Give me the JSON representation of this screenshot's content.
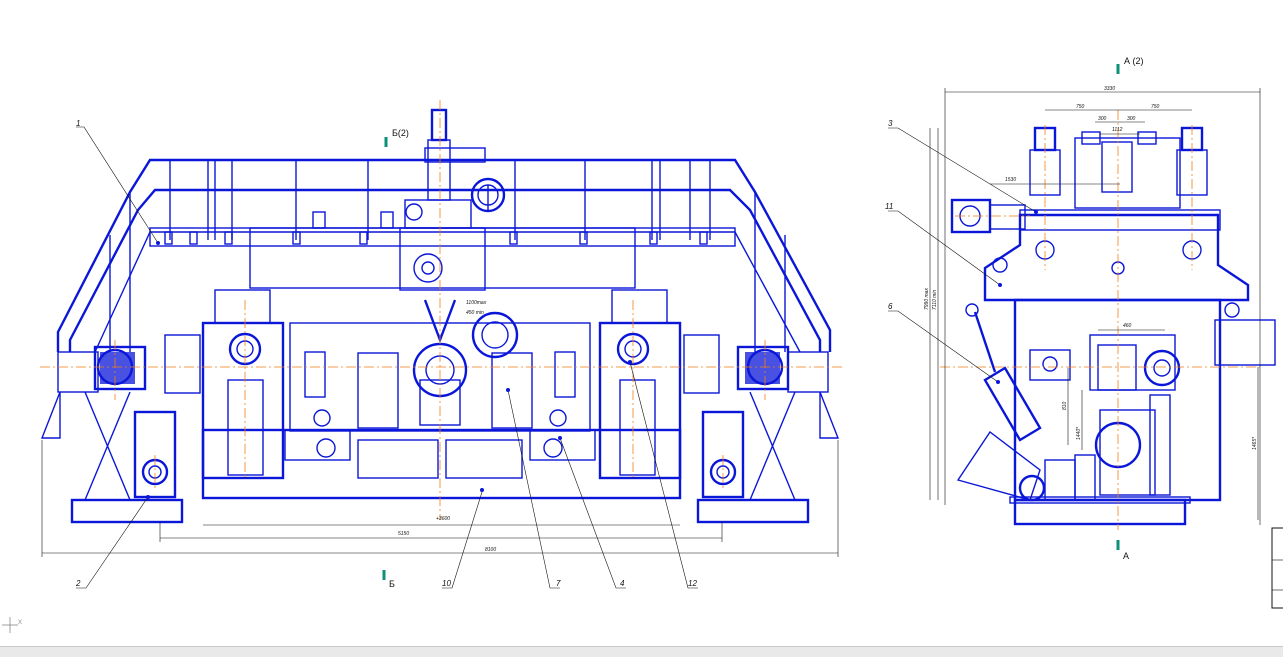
{
  "drawing": {
    "front_view": {
      "section_mark_top": "Б(2)",
      "section_mark_bottom": "Б",
      "callouts": [
        "1",
        "2",
        "10",
        "7",
        "4",
        "12"
      ],
      "dimensions": {
        "overall": "8100",
        "inner": "5150",
        "height_note": "+3600",
        "detail_a": "1100max",
        "detail_b": "450 min"
      }
    },
    "side_view": {
      "section_mark_top": "А (2)",
      "section_mark_bottom": "А",
      "callouts": [
        "3",
        "11",
        "6"
      ],
      "dimensions": {
        "overall_width": "3330",
        "left_span": "750",
        "right_span": "750",
        "pitch_a": "300",
        "pitch_b": "300",
        "centre": "1112",
        "motor_offset": "1530",
        "height_max": "7990 max",
        "height_min": "7110 min",
        "gear_width": "460",
        "gear_h1": "810",
        "gear_h2": "1440*",
        "gear_h3": "1465*"
      }
    },
    "axis_indicator": "X"
  }
}
